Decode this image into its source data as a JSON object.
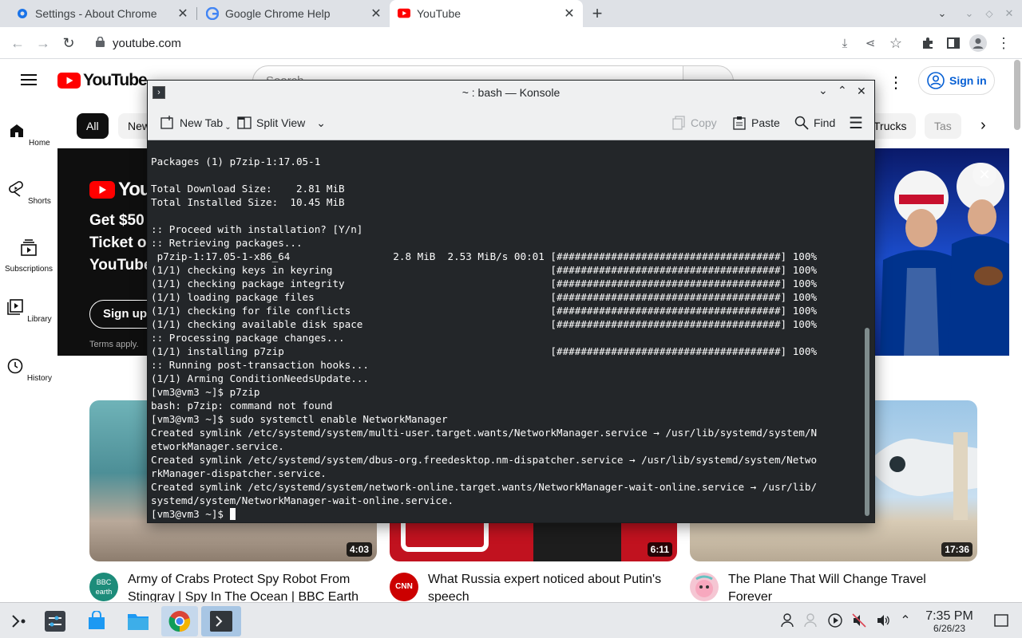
{
  "browser": {
    "tabs": [
      {
        "label": "Settings - About Chrome",
        "icon": "gear-icon"
      },
      {
        "label": "Google Chrome Help",
        "icon": "google-icon"
      },
      {
        "label": "YouTube",
        "icon": "youtube-icon"
      }
    ],
    "url": "youtube.com"
  },
  "youtube": {
    "logo_text": "YouTube",
    "search_placeholder": "Search",
    "sign_in": "Sign in",
    "nav": [
      {
        "label": "Home",
        "icon": "home-icon"
      },
      {
        "label": "Shorts",
        "icon": "shorts-icon"
      },
      {
        "label": "Subscriptions",
        "icon": "subscriptions-icon"
      },
      {
        "label": "Library",
        "icon": "library-icon"
      },
      {
        "label": "History",
        "icon": "history-icon"
      }
    ],
    "chips": [
      "All",
      "New",
      "Trucks",
      "Tas"
    ],
    "banner": {
      "line1": "Get $50",
      "line2": "Ticket o",
      "line3": "YouTube",
      "logo_partial": "You",
      "cta": "Sign up n",
      "terms": "Terms apply."
    },
    "videos": [
      {
        "title": "Army of Crabs Protect Spy Robot From Stingray | Spy In The Ocean | BBC Earth",
        "duration": "4:03",
        "channel_badge": "BBC earth"
      },
      {
        "title": "What Russia expert noticed about Putin's speech",
        "duration": "6:11",
        "channel_badge": "CNN"
      },
      {
        "title": "The Plane That Will Change Travel Forever",
        "duration": "17:36",
        "channel_badge": ""
      }
    ]
  },
  "konsole": {
    "title": "~ : bash — Konsole",
    "toolbar": {
      "new_tab": "New Tab",
      "split_view": "Split View",
      "copy": "Copy",
      "paste": "Paste",
      "find": "Find"
    },
    "lines": [
      "Packages (1) p7zip-1:17.05-1",
      "",
      "Total Download Size:    2.81 MiB",
      "Total Installed Size:  10.45 MiB",
      "",
      ":: Proceed with installation? [Y/n]",
      ":: Retrieving packages...",
      " p7zip-1:17.05-1-x86_64                 2.8 MiB  2.53 MiB/s 00:01 [#####################################] 100%",
      "(1/1) checking keys in keyring                                    [#####################################] 100%",
      "(1/1) checking package integrity                                  [#####################################] 100%",
      "(1/1) loading package files                                       [#####################################] 100%",
      "(1/1) checking for file conflicts                                 [#####################################] 100%",
      "(1/1) checking available disk space                               [#####################################] 100%",
      ":: Processing package changes...",
      "(1/1) installing p7zip                                            [#####################################] 100%",
      ":: Running post-transaction hooks...",
      "(1/1) Arming ConditionNeedsUpdate...",
      "[vm3@vm3 ~]$ p7zip",
      "bash: p7zip: command not found",
      "[vm3@vm3 ~]$ sudo systemctl enable NetworkManager",
      "Created symlink /etc/systemd/system/multi-user.target.wants/NetworkManager.service → /usr/lib/systemd/system/N",
      "etworkManager.service.",
      "Created symlink /etc/systemd/system/dbus-org.freedesktop.nm-dispatcher.service → /usr/lib/systemd/system/Netwo",
      "rkManager-dispatcher.service.",
      "Created symlink /etc/systemd/system/network-online.target.wants/NetworkManager-wait-online.service → /usr/lib/",
      "systemd/system/NetworkManager-wait-online.service."
    ],
    "prompt": "[vm3@vm3 ~]$ "
  },
  "taskbar": {
    "time": "7:35 PM",
    "date": "6/26/23"
  }
}
